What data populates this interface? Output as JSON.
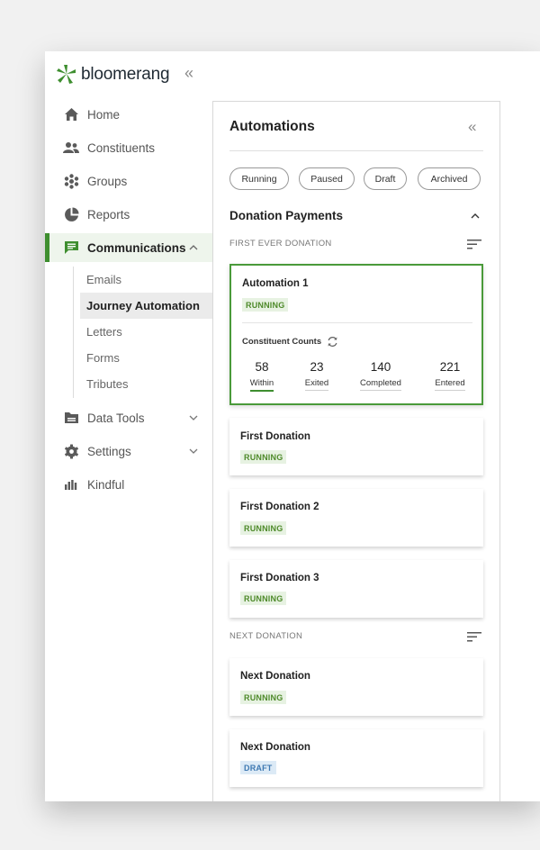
{
  "brand": {
    "name": "bloomerang"
  },
  "sidebar": {
    "items": [
      {
        "label": "Home",
        "icon": "home-icon"
      },
      {
        "label": "Constituents",
        "icon": "people-icon"
      },
      {
        "label": "Groups",
        "icon": "groups-icon"
      },
      {
        "label": "Reports",
        "icon": "reports-icon"
      },
      {
        "label": "Communications",
        "icon": "chat-icon",
        "expanded": true,
        "active": true
      },
      {
        "label": "Data Tools",
        "icon": "folder-icon"
      },
      {
        "label": "Settings",
        "icon": "gear-icon"
      },
      {
        "label": "Kindful",
        "icon": "kindful-icon"
      }
    ],
    "sub_items": [
      {
        "label": "Emails"
      },
      {
        "label": "Journey Automation",
        "active": true
      },
      {
        "label": "Letters"
      },
      {
        "label": "Forms"
      },
      {
        "label": "Tributes"
      }
    ]
  },
  "automations": {
    "title": "Automations",
    "filters": [
      "Running",
      "Paused",
      "Draft",
      "Archived"
    ],
    "section_title": "Donation Payments",
    "group_first": "FIRST EVER DONATION",
    "group_next": "NEXT DONATION",
    "selected_card": {
      "title": "Automation 1",
      "status": "RUNNING",
      "counts_label": "Constituent Counts",
      "counts": [
        {
          "value": "58",
          "label": "Within"
        },
        {
          "value": "23",
          "label": "Exited"
        },
        {
          "value": "140",
          "label": "Completed"
        },
        {
          "value": "221",
          "label": "Entered"
        }
      ]
    },
    "cards": [
      {
        "title": "First Donation",
        "status": "RUNNING"
      },
      {
        "title": "First Donation 2",
        "status": "RUNNING"
      },
      {
        "title": "First Donation 3",
        "status": "RUNNING"
      },
      {
        "title": "Next Donation",
        "status": "RUNNING"
      },
      {
        "title": "Next Donation",
        "status": "DRAFT"
      }
    ]
  },
  "colors": {
    "brand_green": "#3e8e2f",
    "running_text": "#4e8a2a",
    "draft_text": "#3f79b2"
  }
}
